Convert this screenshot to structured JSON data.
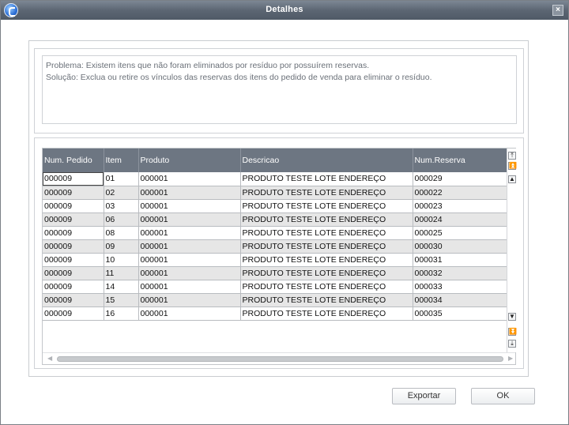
{
  "window": {
    "title": "Detalhes",
    "close_glyph": "×"
  },
  "message": {
    "problem": "Problema: Existem itens que não foram eliminados por resíduo por possuírem reservas.",
    "solution": "Solução: Exclua ou retire os vínculos das reservas dos itens do pedido de venda para eliminar o resíduo."
  },
  "grid": {
    "columns": [
      "Num. Pedido",
      "Item",
      "Produto",
      "Descricao",
      "Num.Reserva"
    ],
    "rows": [
      [
        "000009",
        "01",
        "000001",
        "PRODUTO TESTE LOTE ENDEREÇO",
        "000029"
      ],
      [
        "000009",
        "02",
        "000001",
        "PRODUTO TESTE LOTE ENDEREÇO",
        "000022"
      ],
      [
        "000009",
        "03",
        "000001",
        "PRODUTO TESTE LOTE ENDEREÇO",
        "000023"
      ],
      [
        "000009",
        "06",
        "000001",
        "PRODUTO TESTE LOTE ENDEREÇO",
        "000024"
      ],
      [
        "000009",
        "08",
        "000001",
        "PRODUTO TESTE LOTE ENDEREÇO",
        "000025"
      ],
      [
        "000009",
        "09",
        "000001",
        "PRODUTO TESTE LOTE ENDEREÇO",
        "000030"
      ],
      [
        "000009",
        "10",
        "000001",
        "PRODUTO TESTE LOTE ENDEREÇO",
        "000031"
      ],
      [
        "000009",
        "11",
        "000001",
        "PRODUTO TESTE LOTE ENDEREÇO",
        "000032"
      ],
      [
        "000009",
        "14",
        "000001",
        "PRODUTO TESTE LOTE ENDEREÇO",
        "000033"
      ],
      [
        "000009",
        "15",
        "000001",
        "PRODUTO TESTE LOTE ENDEREÇO",
        "000034"
      ],
      [
        "000009",
        "16",
        "000001",
        "PRODUTO TESTE LOTE ENDEREÇO",
        "000035"
      ]
    ]
  },
  "buttons": {
    "export_label": "Exportar",
    "ok_label": "OK"
  },
  "icons": {
    "app": "app-logo-icon",
    "close": "close-icon",
    "scroll_top": "scroll-top-icon",
    "page_up": "page-up-icon",
    "line_up": "line-up-icon",
    "line_down": "line-down-icon",
    "page_down": "page-down-icon",
    "scroll_bottom": "scroll-bottom-icon"
  },
  "colors": {
    "titlebar": "#5c6673",
    "header": "#6d7682",
    "row_alt": "#e6e6e6"
  }
}
